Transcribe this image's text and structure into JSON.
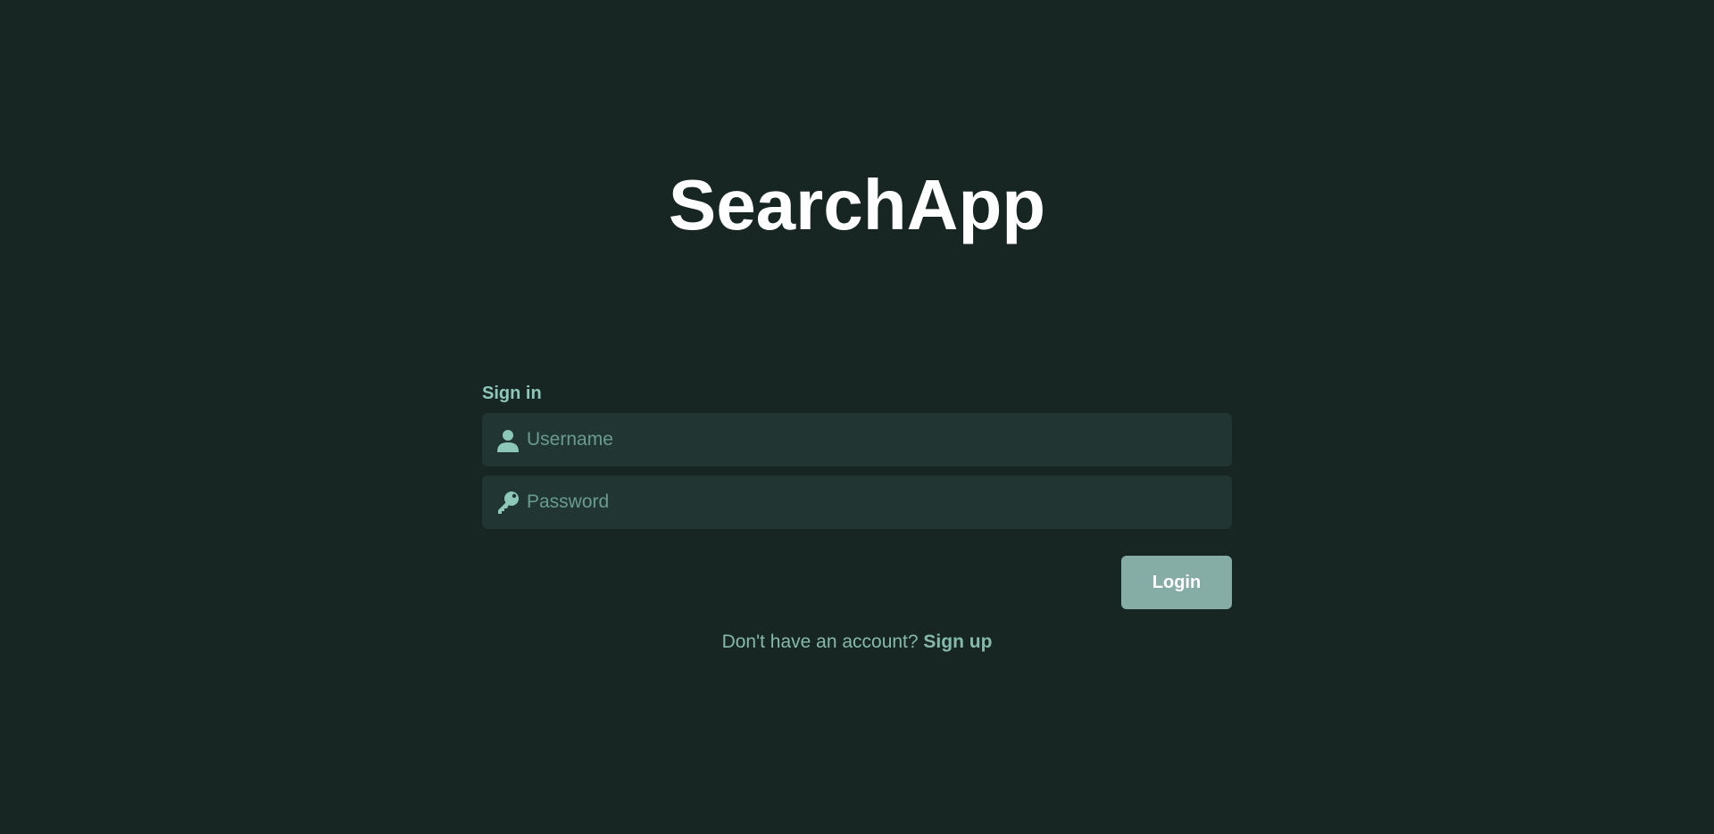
{
  "app": {
    "title": "SearchApp"
  },
  "login_form": {
    "heading": "Sign in",
    "username": {
      "value": "",
      "placeholder": "Username",
      "icon": "user-icon"
    },
    "password": {
      "value": "",
      "placeholder": "Password",
      "icon": "key-icon"
    },
    "login_button_label": "Login",
    "signup_prompt": "Don't have an account?",
    "signup_link_label": "Sign up"
  },
  "colors": {
    "background": "#172622",
    "field_background": "#213632",
    "accent": "#8cc7b8",
    "button": "#86aca6",
    "title": "#ffffff"
  }
}
